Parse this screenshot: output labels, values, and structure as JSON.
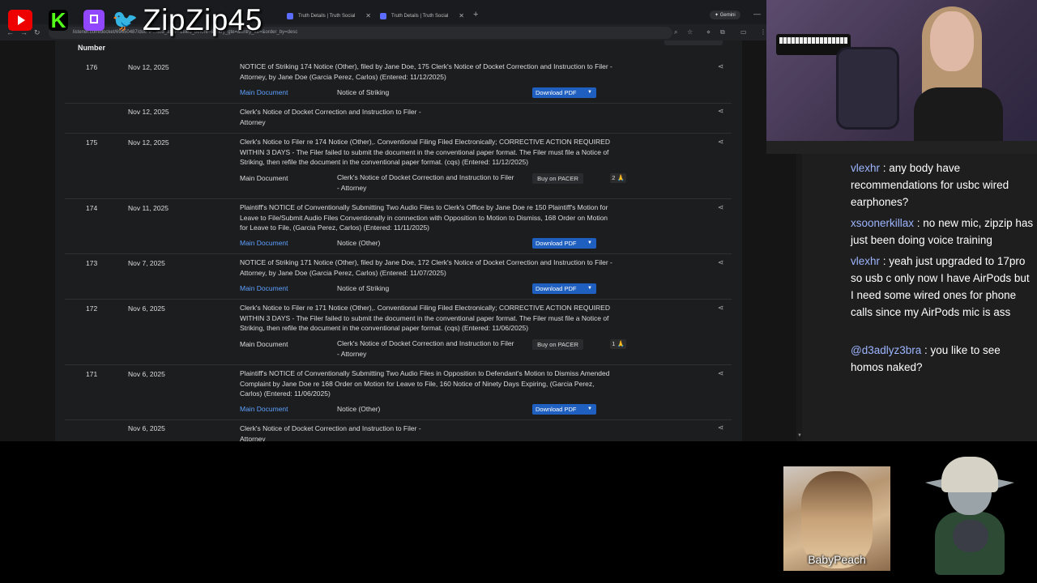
{
  "overlay": {
    "streamer_name": "ZipZip45",
    "logos": [
      "youtube-icon",
      "kick-icon",
      "twitch-icon",
      "twitter-icon"
    ]
  },
  "browser": {
    "tabs": [
      {
        "label": "Truth Details | Truth Social"
      },
      {
        "label": "Truth Details | Truth Social"
      }
    ],
    "new_tab_label": "+",
    "gemini_label": "✦ Gemini",
    "address": "listener.com/docket/69650487/doe-v-...lied_after=&filed_before=&entry_gte=&entry_lte=&order_by=desc"
  },
  "docket": {
    "column_header": "Number",
    "main_doc_label": "Main Document",
    "download_label": "Download PDF",
    "pacer_label": "Buy on PACER",
    "rows": [
      {
        "number": "176",
        "date": "Nov 12, 2025",
        "description": "NOTICE of Striking 174 Notice (Other), filed by Jane Doe, 175 Clerk's Notice of Docket Correction and Instruction to Filer - Attorney, by Jane Doe (Garcia Perez, Carlos) (Entered: 11/12/2025)",
        "attachment": "Notice of Striking",
        "action": "download"
      },
      {
        "number": "",
        "date": "Nov 12, 2025",
        "description": "Clerk's Notice of Docket Correction and Instruction to Filer - Attorney"
      },
      {
        "number": "175",
        "date": "Nov 12, 2025",
        "description": "Clerk's Notice to Filer re 174 Notice (Other),. Conventional Filing Filed Electronically; CORRECTIVE ACTION REQUIRED WITHIN 3 DAYS - The Filer failed to submit the document in the conventional paper format. The Filer must file a Notice of Striking, then refile the document in the conventional paper format. (cqs) (Entered: 11/12/2025)",
        "attachment": "Clerk's Notice of Docket Correction and Instruction to Filer - Attorney",
        "action": "pacer",
        "badge": "2 🙏"
      },
      {
        "number": "174",
        "date": "Nov 11, 2025",
        "description": "Plaintiff's NOTICE of Conventionally Submitting Two Audio Files to Clerk's Office by Jane Doe re 150 Plaintiff's Motion for Leave to File/Submit Audio Files Conventionally in connection with Opposition to Motion to Dismiss, 168 Order on Motion for Leave to File, (Garcia Perez, Carlos) (Entered: 11/11/2025)",
        "attachment": "Notice (Other)",
        "action": "download"
      },
      {
        "number": "173",
        "date": "Nov 7, 2025",
        "description": "NOTICE of Striking 171 Notice (Other), filed by Jane Doe, 172 Clerk's Notice of Docket Correction and Instruction to Filer - Attorney, by Jane Doe (Garcia Perez, Carlos) (Entered: 11/07/2025)",
        "attachment": "Notice of Striking",
        "action": "download"
      },
      {
        "number": "172",
        "date": "Nov 6, 2025",
        "description": "Clerk's Notice to Filer re 171 Notice (Other),. Conventional Filing Filed Electronically; CORRECTIVE ACTION REQUIRED WITHIN 3 DAYS - The Filer failed to submit the document in the conventional paper format. The Filer must file a Notice of Striking, then refile the document in the conventional paper format. (cqs) (Entered: 11/06/2025)",
        "attachment": "Clerk's Notice of Docket Correction and Instruction to Filer - Attorney",
        "action": "pacer",
        "badge": "1 🙏"
      },
      {
        "number": "171",
        "date": "Nov 6, 2025",
        "description": "Plaintiff's NOTICE of Conventionally Submitting Two Audio Files in Opposition to Defendant's Motion to Dismiss Amended Complaint by Jane Doe re 168 Order on Motion for Leave to File, 160 Notice of Ninety Days Expiring, (Garcia Perez, Carlos) (Entered: 11/06/2025)",
        "attachment": "Notice (Other)",
        "action": "download"
      },
      {
        "number": "",
        "date": "Nov 6, 2025",
        "description": "Clerk's Notice of Docket Correction and Instruction to Filer - Attorney"
      }
    ]
  },
  "chat": [
    {
      "user": "vlexhr",
      "text": " : any body have recommendations for usbc wired earphones?"
    },
    {
      "user": "xsoonerkillax",
      "text": " : no new mic, zipzip has just been doing voice training"
    },
    {
      "user": "vlexhr",
      "text": " : yeah just upgraded to 17pro so usb c only now I have AirPods but I need some wired ones for phone calls since my AirPods mic is ass"
    },
    {
      "user": "@d3adlyz3bra",
      "text": " : you like to see homos naked?"
    }
  ],
  "avatars": {
    "peach_label": "BabyPeach"
  },
  "colors": {
    "link": "#5ea0ff",
    "download_button": "#1f5fbf",
    "chat_username": "#9db5ff"
  }
}
